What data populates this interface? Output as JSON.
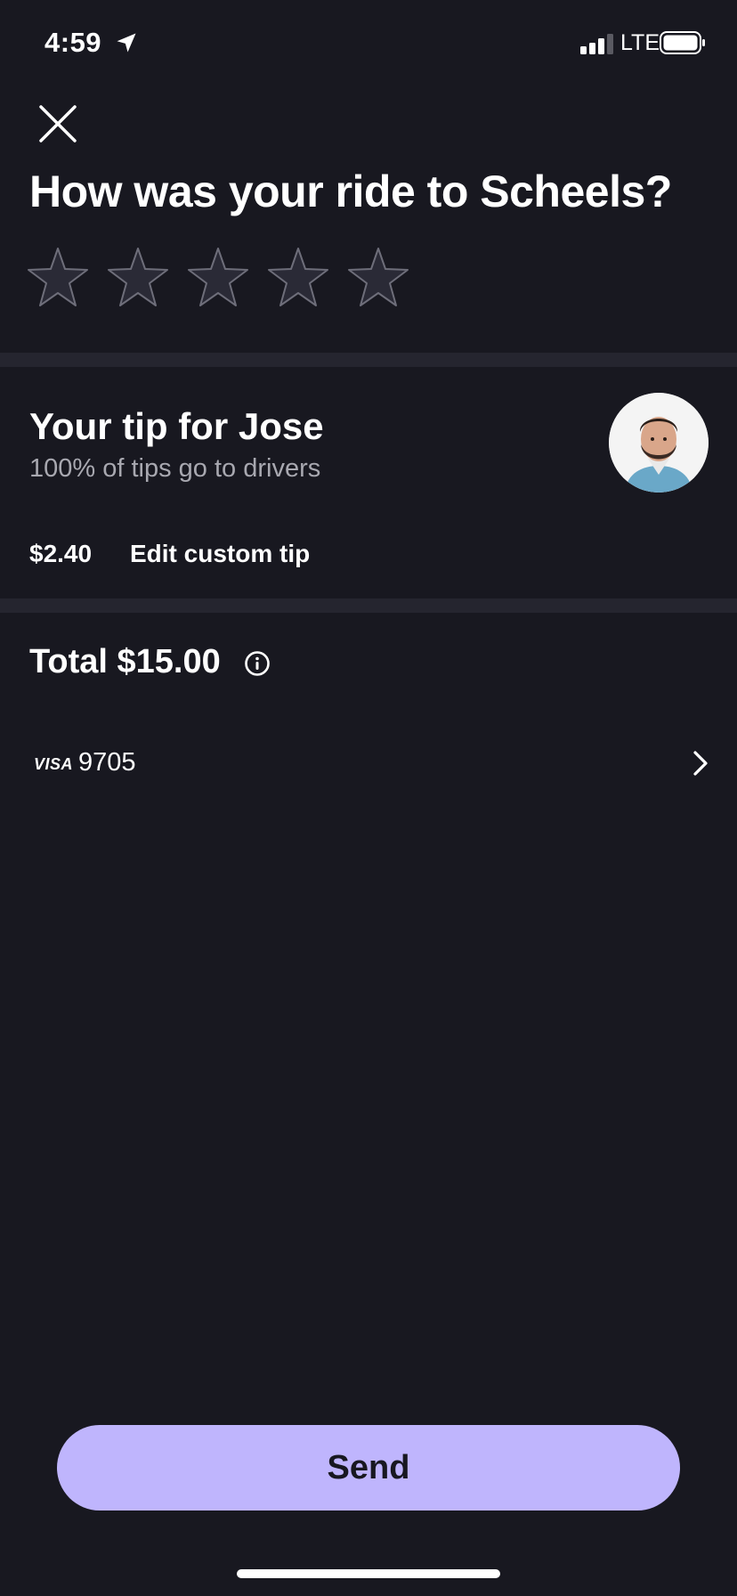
{
  "status_bar": {
    "time": "4:59",
    "network": "LTE",
    "icons": [
      "location-arrow-icon",
      "signal-icon",
      "battery-icon"
    ]
  },
  "header": {
    "close_icon": "close-icon",
    "title": "How was your ride to Scheels?"
  },
  "rating": {
    "max_stars": 5,
    "selected": 0,
    "icon": "star-icon"
  },
  "tip": {
    "title": "Your tip for Jose",
    "subtitle": "100% of tips go to drivers",
    "amount": "$2.40",
    "edit_label": "Edit custom tip",
    "avatar_icon": "driver-avatar"
  },
  "total": {
    "label": "Total $15.00",
    "info_icon": "info-icon"
  },
  "payment": {
    "brand": "VISA",
    "last4": "9705",
    "chevron_icon": "chevron-right-icon"
  },
  "actions": {
    "send_label": "Send"
  },
  "colors": {
    "background": "#181820",
    "divider": "#25252f",
    "accent": "#bfb5fd",
    "star_fill": "#2a2a36",
    "star_stroke": "#6e6e7a",
    "subtle_text": "#a8a8b0"
  }
}
